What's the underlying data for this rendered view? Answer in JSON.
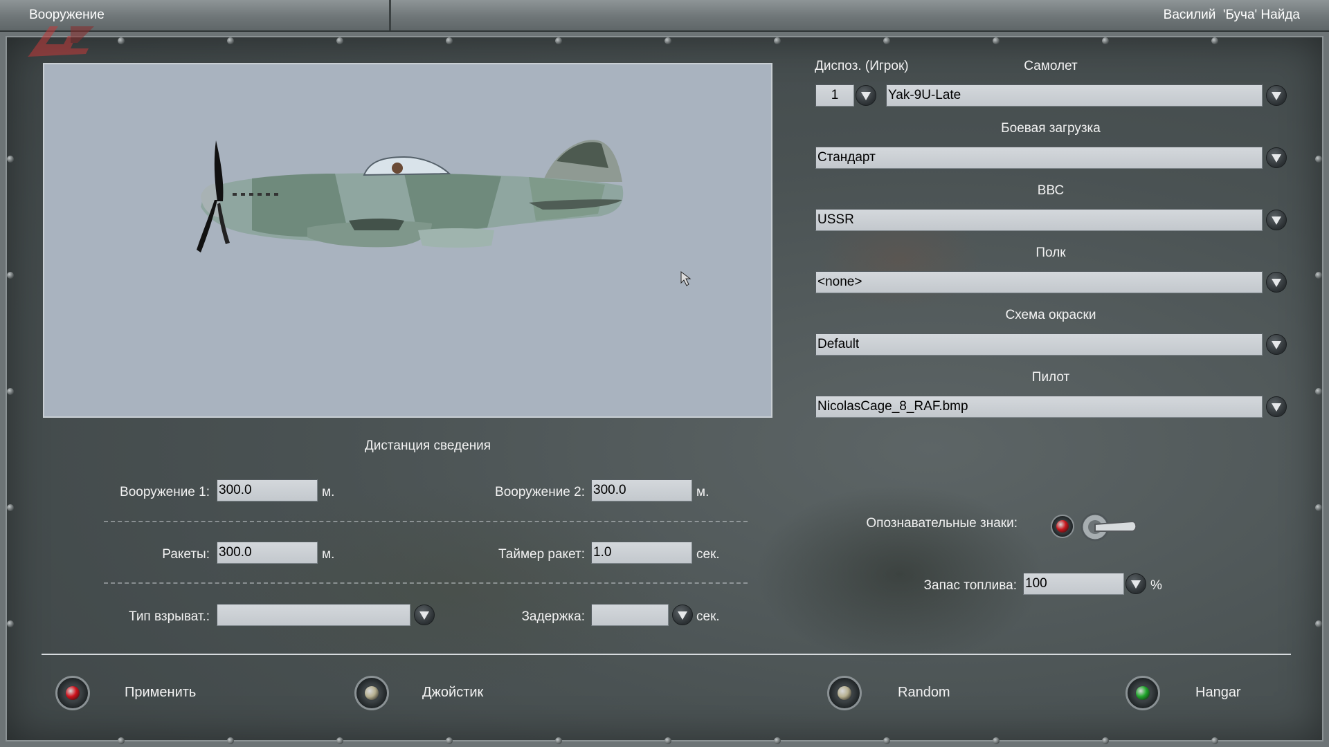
{
  "header": {
    "title": "Вооружение",
    "user": "Василий  'Буча' Найда"
  },
  "preview": {
    "aircraft_icon": "yak-9u-aircraft-icon"
  },
  "aircraft": {
    "slot_label": "Диспоз. (Игрок)",
    "slot_value": "1",
    "plane_label": "Самолет",
    "plane_value": "Yak-9U-Late",
    "loadout_label": "Боевая загрузка",
    "loadout_value": "Стандарт",
    "airforce_label": "ВВС",
    "airforce_value": "USSR",
    "regiment_label": "Полк",
    "regiment_value": "<none>",
    "skin_label": "Схема окраски",
    "skin_value": "Default",
    "pilot_label": "Пилот",
    "pilot_value": "NicolasCage_8_RAF.bmp"
  },
  "convergence": {
    "title": "Дистанция сведения",
    "gun1_label": "Вооружение 1:",
    "gun1_value": "300.0",
    "gun1_unit": "м.",
    "gun2_label": "Вооружение 2:",
    "gun2_value": "300.0",
    "gun2_unit": "м.",
    "rockets_label": "Ракеты:",
    "rockets_value": "300.0",
    "rockets_unit": "м.",
    "rocket_timer_label": "Таймер ракет:",
    "rocket_timer_value": "1.0",
    "rocket_timer_unit": "сек.",
    "fuze_label": "Тип взрыват.:",
    "fuze_value": "",
    "delay_label": "Задержка:",
    "delay_value": "",
    "delay_unit": "сек."
  },
  "markings": {
    "label": "Опознавательные знаки:",
    "lamp_color": "#c8161c"
  },
  "fuel": {
    "label": "Запас топлива:",
    "value": "100",
    "unit": "%"
  },
  "buttons": {
    "apply": {
      "label": "Применить",
      "lamp_color": "#d0121c"
    },
    "joystick": {
      "label": "Джойстик",
      "lamp_color": "#b7b090"
    },
    "random": {
      "label": "Random",
      "lamp_color": "#b7b090"
    },
    "hangar": {
      "label": "Hangar",
      "lamp_color": "#1fa62a"
    }
  }
}
